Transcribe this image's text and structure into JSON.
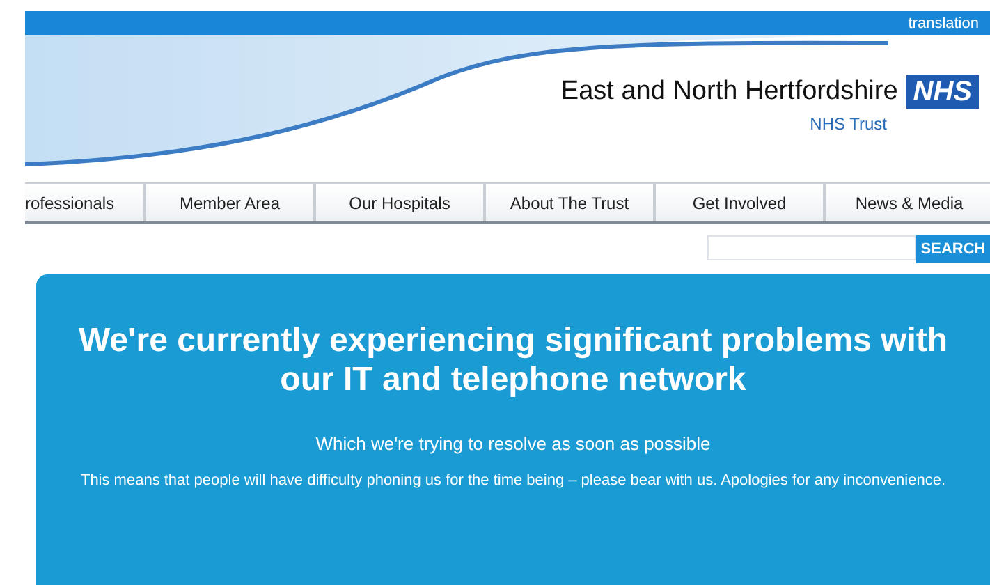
{
  "top_bar": {
    "link": "translation"
  },
  "header": {
    "org_name": "East and North Hertfordshire",
    "logo": "NHS",
    "subtitle": "NHS Trust"
  },
  "nav": {
    "items": [
      {
        "label": "rofessionals"
      },
      {
        "label": "Member Area"
      },
      {
        "label": "Our Hospitals"
      },
      {
        "label": "About The Trust"
      },
      {
        "label": "Get Involved"
      },
      {
        "label": "News & Media"
      }
    ]
  },
  "search": {
    "button": "SEARCH"
  },
  "notice": {
    "heading": "We're currently experiencing significant problems with our IT and telephone network",
    "subheading": "Which we're trying to resolve as soon as possible",
    "body": "This means that people will have difficulty phoning us for the time being – please bear with us. Apologies for any inconvenience."
  }
}
